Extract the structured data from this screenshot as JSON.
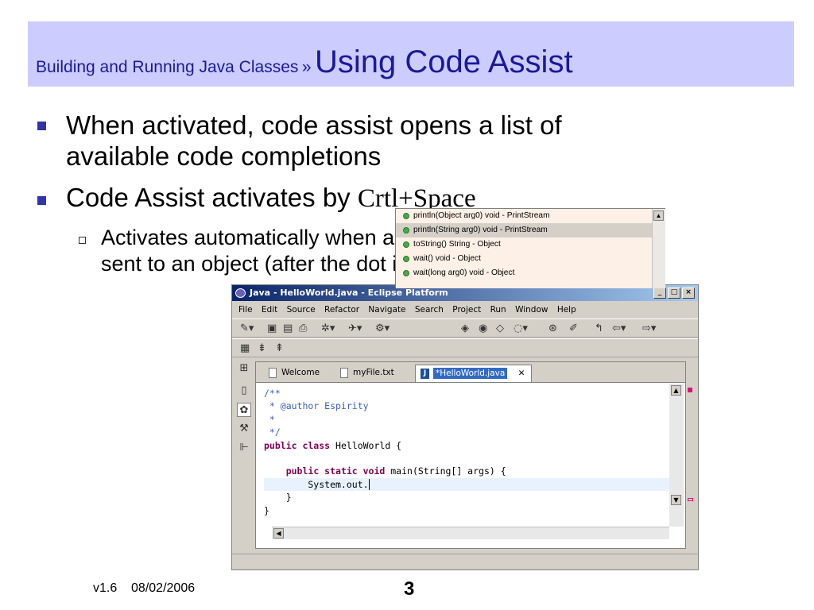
{
  "slide": {
    "breadcrumb": "Building and Running Java Classes",
    "separator": "»",
    "title": "Using Code Assist",
    "bullet1_line1": "When activated, code assist opens a list of",
    "bullet1_line2": "available code completions",
    "bullet2_text": "Code Assist activates by ",
    "bullet2_key": "Crtl+Space",
    "sub1_line1": "Activates automatically when a message needs to be",
    "sub1_line2": "sent to an object (after the dot is typed)",
    "footer_version": "v1.6",
    "footer_date": "08/02/2006",
    "page_number": "3",
    "banner_color": "#ccccff",
    "bullet_color": "#3333aa"
  },
  "eclipse": {
    "window_title": "Java - HelloWorld.java - Eclipse Platform",
    "menu": [
      "File",
      "Edit",
      "Source",
      "Refactor",
      "Navigate",
      "Search",
      "Project",
      "Run",
      "Window",
      "Help"
    ],
    "tabs": [
      "Welcome",
      "myFile.txt",
      "*HelloWorld.java"
    ],
    "code_lines": [
      {
        "parts": [
          {
            "c": "cm",
            "t": "/**"
          }
        ]
      },
      {
        "parts": [
          {
            "c": "cm",
            "t": " * @author Espirity"
          }
        ]
      },
      {
        "parts": [
          {
            "c": "cm",
            "t": " *"
          }
        ]
      },
      {
        "parts": [
          {
            "c": "cm",
            "t": " */"
          }
        ]
      },
      {
        "parts": [
          {
            "c": "kw",
            "t": "public class"
          },
          {
            "c": "",
            "t": " HelloWorld {"
          }
        ]
      },
      {
        "parts": [
          {
            "c": "",
            "t": ""
          }
        ]
      },
      {
        "parts": [
          {
            "c": "",
            "t": "    "
          },
          {
            "c": "kw",
            "t": "public static void"
          },
          {
            "c": "",
            "t": " main(String[] args) {"
          }
        ]
      },
      {
        "parts": [
          {
            "c": "",
            "t": "        System.out."
          }
        ],
        "highlight": true
      },
      {
        "parts": [
          {
            "c": "",
            "t": "    }"
          }
        ]
      },
      {
        "parts": [
          {
            "c": "",
            "t": "}"
          }
        ]
      }
    ],
    "completions": [
      "println(Object arg0)  void - PrintStream",
      "println(String arg0)  void - PrintStream",
      "toString()  String - Object",
      "wait()  void - Object",
      "wait(long arg0)  void - Object"
    ],
    "selected_completion": 1
  }
}
